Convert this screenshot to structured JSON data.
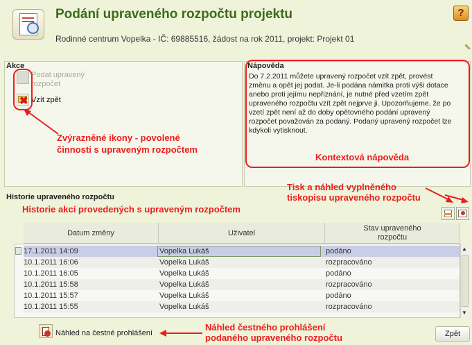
{
  "header": {
    "title": "Podání upraveného rozpočtu projektu",
    "subtitle": "Rodinné centrum Vopelka - IČ: 69885516, žádost na rok 2011, projekt: Projekt 01",
    "help_label": "?"
  },
  "akce": {
    "title": "Akce",
    "submit_line1": "Podat upravený",
    "submit_line2": "rozpočet",
    "withdraw_label": "Vzít zpět"
  },
  "napoveda": {
    "title": "Nápověda",
    "lines": [
      "Do 7.2.2011 můžete upravený rozpočet vzít zpět, provést",
      "změnu a opět jej podat. Je-li podána námitka proti výši dotace",
      "anebo proti jejímu nepřiznání, je nutné před vzetím zpět",
      "upraveného rozpočtu vzít zpět nejprve ji. Upozorňujeme, že po",
      "vzetí zpět není až do doby opětovného podání upravený",
      "rozpočet považován za podaný. Podaný upravený rozpočet lze",
      "kdykoli vytisknout."
    ]
  },
  "annotations": {
    "icons_line1": "Zvýrazněné ikony - povolené",
    "icons_line2": "činnosti s upraveným rozpočtem",
    "context_help": "Kontextová nápověda",
    "print_line1": "Tisk a náhled vyplněného",
    "print_line2": "tiskopisu upraveného rozpočtu",
    "history": "Historie akcí provedených s upraveným rozpočtem",
    "statement_line1": "Náhled čestného prohlášení",
    "statement_line2": "podaného upraveného rozpočtu"
  },
  "history": {
    "title": "Historie upraveného rozpočtu",
    "columns": [
      "Datum změny",
      "Uživatel",
      "Stav upraveného",
      "rozpočtu"
    ],
    "rows": [
      {
        "date": "17.1.2011 14:09",
        "user": "Vopelka Lukáš",
        "state": "podáno"
      },
      {
        "date": "10.1.2011 16:06",
        "user": "Vopelka Lukáš",
        "state": "rozpracováno"
      },
      {
        "date": "10.1.2011 16:05",
        "user": "Vopelka Lukáš",
        "state": "podáno"
      },
      {
        "date": "10.1.2011 15:58",
        "user": "Vopelka Lukáš",
        "state": "rozpracováno"
      },
      {
        "date": "10.1.2011 15:57",
        "user": "Vopelka Lukáš",
        "state": "podáno"
      },
      {
        "date": "10.1.2011 15:55",
        "user": "Vopelka Lukáš",
        "state": "rozpracováno"
      }
    ]
  },
  "footer": {
    "statement_label": "Náhled na čestné prohlášení",
    "back_label": "Zpět"
  },
  "colors": {
    "accent_red": "#ee1c1c",
    "title_green": "#3e6a1b",
    "selected_row": "#c9cde6"
  }
}
